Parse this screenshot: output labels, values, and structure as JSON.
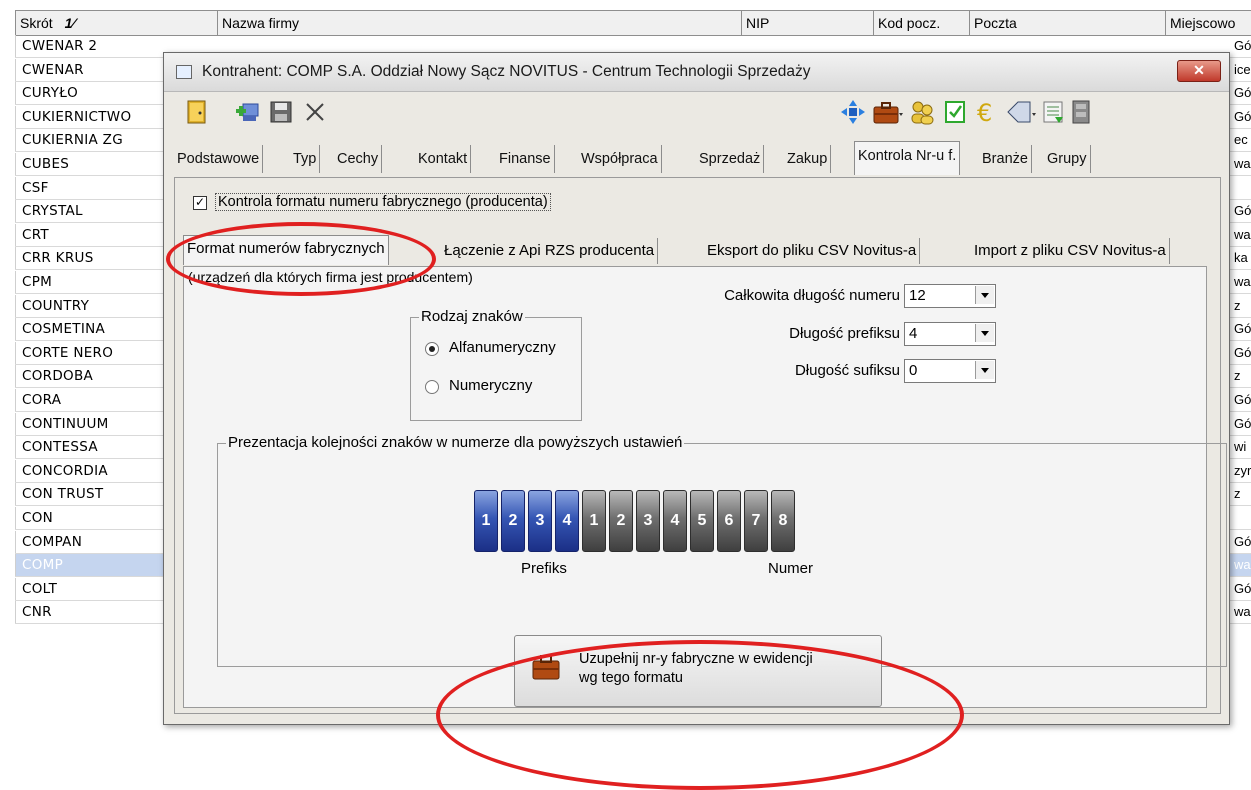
{
  "grid": {
    "headers": [
      "Skrót",
      "Nazwa firmy",
      "NIP",
      "Kod pocz.",
      "Poczta",
      "Miejscowo"
    ],
    "sort_indicator": "1⁄",
    "rows": [
      {
        "short": "CWENAR 2",
        "right": "Gó"
      },
      {
        "short": "CWENAR",
        "right": "ice"
      },
      {
        "short": "CURYŁO",
        "right": "Gó"
      },
      {
        "short": "CUKIERNICTWO",
        "right": "Gó"
      },
      {
        "short": "CUKIERNIA ZG",
        "right": "ec"
      },
      {
        "short": "CUBES",
        "right": "wa"
      },
      {
        "short": "CSF",
        "right": ""
      },
      {
        "short": "CRYSTAL",
        "right": "Gó"
      },
      {
        "short": "CRT",
        "right": "wa"
      },
      {
        "short": "CRR KRUS",
        "right": "ka"
      },
      {
        "short": "CPM",
        "right": "wa"
      },
      {
        "short": "COUNTRY",
        "right": "z"
      },
      {
        "short": "COSMETINA",
        "right": "Gó"
      },
      {
        "short": "CORTE NERO",
        "right": "Gó"
      },
      {
        "short": "CORDOBA",
        "right": "z"
      },
      {
        "short": "CORA",
        "right": "Gó"
      },
      {
        "short": "CONTINUUM",
        "right": "Gó"
      },
      {
        "short": "CONTESSA",
        "right": "wi"
      },
      {
        "short": "CONCORDIA",
        "right": "zyr"
      },
      {
        "short": "CON TRUST",
        "right": "z"
      },
      {
        "short": "CON",
        "right": ""
      },
      {
        "short": "COMPAN",
        "right": "Gó"
      },
      {
        "short": "COMP",
        "right": "wa"
      },
      {
        "short": "COLT",
        "right": "Gó"
      },
      {
        "short": "CNR",
        "right": "wa"
      }
    ],
    "selected_row": "COMP"
  },
  "dialog": {
    "title": "Kontrahent: COMP S.A. Oddział Nowy Sącz NOVITUS - Centrum Technologii Sprzedaży",
    "close": "✕",
    "tabs": [
      "Podstawowe",
      "Typ",
      "Cechy",
      "Kontakt",
      "Finanse",
      "Współpraca",
      "Sprzedaż",
      "Zakup",
      "Kontrola Nr-u f.",
      "Branże",
      "Grupy"
    ],
    "active_tab": "Kontrola Nr-u f.",
    "checkbox_label": "Kontrola formatu numeru fabrycznego (producenta)",
    "checkbox_checked": true,
    "subtabs": [
      "Format numerów fabrycznych",
      "Łączenie z Api RZS producenta",
      "Eksport do pliku CSV Novitus-a",
      "Import z pliku CSV Novitus-a"
    ],
    "active_subtab": "Format numerów fabrycznych",
    "description": "(urządzeń dla których firma jest producentem)",
    "char_type": {
      "title": "Rodzaj znaków",
      "options": [
        "Alfanumeryczny",
        "Numeryczny"
      ],
      "selected": "Alfanumeryczny"
    },
    "fields": {
      "total_length": {
        "label": "Całkowita długość numeru",
        "value": "12"
      },
      "prefix_length": {
        "label": "Długość prefiksu",
        "value": "4"
      },
      "suffix_length": {
        "label": "Długość sufiksu",
        "value": "0"
      }
    },
    "presentation": {
      "title": "Prezentacja kolejności znaków w numerze dla powyższych ustawień",
      "prefix": [
        "1",
        "2",
        "3",
        "4"
      ],
      "number": [
        "1",
        "2",
        "3",
        "4",
        "5",
        "6",
        "7",
        "8"
      ],
      "prefix_label": "Prefiks",
      "number_label": "Numer"
    },
    "action_button": {
      "line1": "Uzupełnij nr-y fabryczne w ewidencji",
      "line2": "wg tego formatu"
    }
  },
  "colors": {
    "prefix_blue": "#2a46a6",
    "number_gray": "#5a5a5a",
    "selection": "#c5d5ef",
    "annotation_red": "#e02020"
  }
}
